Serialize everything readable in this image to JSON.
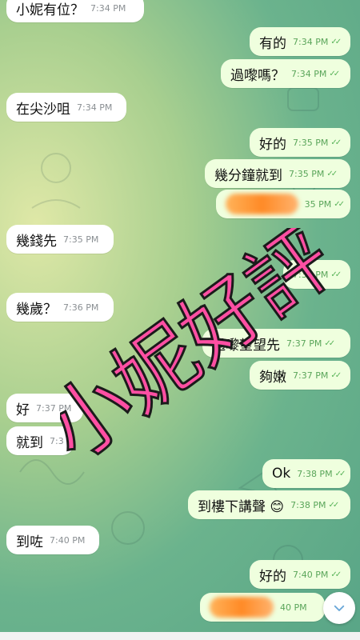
{
  "messages": [
    {
      "id": "m1",
      "text": "小妮有位？",
      "time": "7:34 PM"
    },
    {
      "id": "m2",
      "text": "有的",
      "time": "7:34 PM"
    },
    {
      "id": "m3",
      "text": "過嚟嗎？",
      "time": "7:34 PM"
    },
    {
      "id": "m4",
      "text": "在尖沙咀",
      "time": "7:34 PM"
    },
    {
      "id": "m5",
      "text": "好的",
      "time": "7:35 PM"
    },
    {
      "id": "m6",
      "text": "幾分鐘就到",
      "time": "7:35 PM"
    },
    {
      "id": "m7",
      "text": "",
      "time": "35 PM"
    },
    {
      "id": "m8",
      "text": "幾錢先",
      "time": "7:35 PM"
    },
    {
      "id": "m9",
      "text": "",
      "time": "7:36 PM"
    },
    {
      "id": "m10",
      "text": "幾歲？",
      "time": "7:36 PM"
    },
    {
      "id": "m11",
      "text": "過嚟望望先",
      "time": "7:37 PM"
    },
    {
      "id": "m12",
      "text": "夠嫩",
      "time": "7:37 PM"
    },
    {
      "id": "m13",
      "text": "好",
      "time": "7:37 PM"
    },
    {
      "id": "m14",
      "text": "就到",
      "time": "7:3"
    },
    {
      "id": "m15",
      "text": "Ok",
      "time": "7:38 PM"
    },
    {
      "id": "m16",
      "text": "到樓下講聲 😊",
      "time": "7:38 PM"
    },
    {
      "id": "m17",
      "text": "到咗",
      "time": "7:40 PM"
    },
    {
      "id": "m18",
      "text": "好的",
      "time": "7:40 PM"
    },
    {
      "id": "m19",
      "text": "",
      "time": "40 PM"
    }
  ],
  "overlay_text": "小妮好評",
  "colors": {
    "incoming": "#ffffff",
    "outgoing": "#efffde",
    "overlay": "#ff4fa3",
    "overlay_stroke": "#1b1b1b",
    "check": "#5ab45a"
  },
  "icons": {
    "scroll_down": "chevron-down-icon",
    "read": "double-check-icon"
  }
}
